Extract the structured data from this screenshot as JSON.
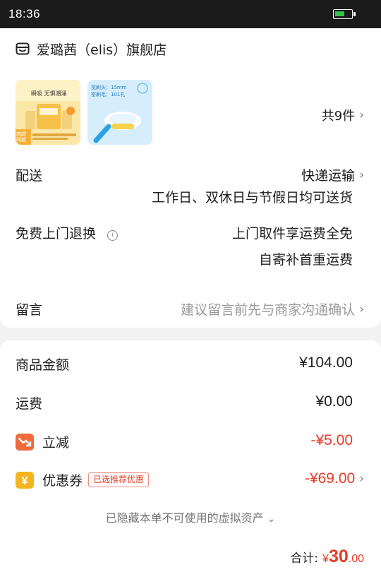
{
  "status_bar": {
    "time": "18:36"
  },
  "store": {
    "name": "爱璐茜（elis）旗舰店"
  },
  "products": {
    "count_label": "共9件",
    "thumb1_texts": [
      "瞬吸 无惧潮涌",
      "商超同款"
    ],
    "thumb2_texts": [
      "宽刷头：15mm",
      "密刷毛：101孔"
    ]
  },
  "delivery": {
    "label": "配送",
    "method": "快递运输",
    "note": "工作日、双休日与节假日均可送货"
  },
  "returns": {
    "label": "免费上门退换",
    "line1": "上门取件享运费全免",
    "line2": "自寄补首重运费"
  },
  "message": {
    "label": "留言",
    "placeholder": "建议留言前先与商家沟通确认"
  },
  "summary": {
    "goods_label": "商品金额",
    "goods_value": "¥104.00",
    "shipping_label": "运费",
    "shipping_value": "¥0.00",
    "discount_label": "立减",
    "discount_value": "-¥5.00",
    "coupon_label": "优惠券",
    "coupon_tag": "已选推荐优惠",
    "coupon_value": "-¥69.00",
    "hidden_note": "已隐藏本单不可使用的虚拟资产"
  },
  "total": {
    "label": "合计:",
    "currency": "¥",
    "integer": "30",
    "decimal": ".00"
  },
  "colors": {
    "accent_red": "#e63a24",
    "discount_icon": "#f06a3a",
    "coupon_icon": "#f5b51d"
  }
}
